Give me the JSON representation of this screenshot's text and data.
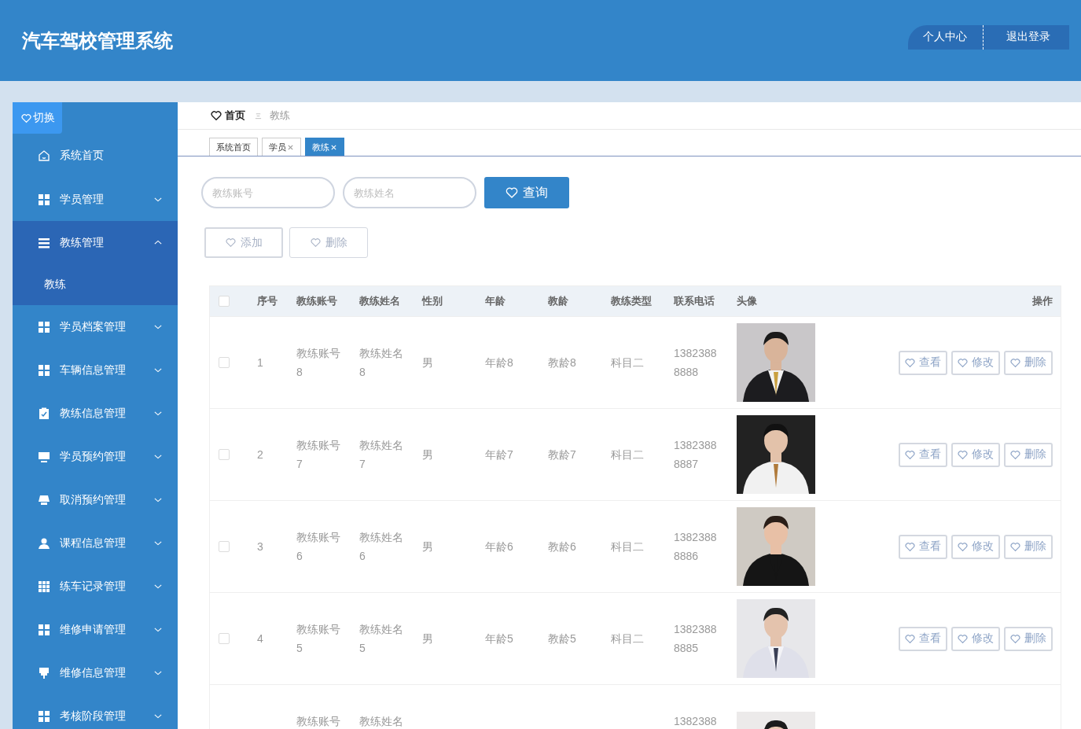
{
  "header": {
    "title": "汽车驾校管理系统",
    "user_menu": [
      "个人中心",
      "退出登录"
    ]
  },
  "sidebar": {
    "toggle": "切换",
    "items": [
      {
        "label": "系统首页",
        "kind": "link"
      },
      {
        "label": "学员管理",
        "kind": "group",
        "expanded": false
      },
      {
        "label": "教练管理",
        "kind": "group",
        "expanded": true,
        "children": [
          {
            "label": "教练",
            "selected": true
          }
        ]
      },
      {
        "label": "学员档案管理",
        "kind": "group",
        "expanded": false
      },
      {
        "label": "车辆信息管理",
        "kind": "group",
        "expanded": false
      },
      {
        "label": "教练信息管理",
        "kind": "group",
        "expanded": false
      },
      {
        "label": "学员预约管理",
        "kind": "group",
        "expanded": false
      },
      {
        "label": "取消预约管理",
        "kind": "group",
        "expanded": false
      },
      {
        "label": "课程信息管理",
        "kind": "group",
        "expanded": false
      },
      {
        "label": "练车记录管理",
        "kind": "group",
        "expanded": false
      },
      {
        "label": "维修申请管理",
        "kind": "group",
        "expanded": false
      },
      {
        "label": "维修信息管理",
        "kind": "group",
        "expanded": false
      },
      {
        "label": "考核阶段管理",
        "kind": "group",
        "expanded": false
      }
    ]
  },
  "breadcrumb": [
    "首页",
    "教练"
  ],
  "tabs": [
    {
      "label": "系统首页",
      "closable": false,
      "selected": false
    },
    {
      "label": "学员",
      "closable": true,
      "selected": false
    },
    {
      "label": "教练",
      "closable": true,
      "selected": true
    }
  ],
  "search": {
    "fields": [
      {
        "placeholder": "教练账号"
      },
      {
        "placeholder": "教练姓名"
      }
    ],
    "button": "查询"
  },
  "actions": [
    "添加",
    "删除"
  ],
  "table": {
    "select_all": {
      "checked": false
    },
    "columns": [
      "序号",
      "教练账号",
      "教练姓名",
      "性别",
      "年龄",
      "教龄",
      "教练类型",
      "联系电话",
      "头像",
      "操作"
    ],
    "rows": [
      {
        "checked": false,
        "cells": [
          "1",
          "教练账号8",
          "教练姓名8",
          "男",
          "年龄8",
          "教龄8",
          "科目二",
          "13823888888"
        ],
        "actions": [
          "查看",
          "修改",
          "删除"
        ]
      },
      {
        "checked": false,
        "cells": [
          "2",
          "教练账号7",
          "教练姓名7",
          "男",
          "年龄7",
          "教龄7",
          "科目二",
          "13823888887"
        ],
        "actions": [
          "查看",
          "修改",
          "删除"
        ]
      },
      {
        "checked": false,
        "cells": [
          "3",
          "教练账号6",
          "教练姓名6",
          "男",
          "年龄6",
          "教龄6",
          "科目二",
          "13823888886"
        ],
        "actions": [
          "查看",
          "修改",
          "删除"
        ]
      },
      {
        "checked": false,
        "cells": [
          "4",
          "教练账号5",
          "教练姓名5",
          "男",
          "年龄5",
          "教龄5",
          "科目二",
          "13823888885"
        ],
        "actions": [
          "查看",
          "修改",
          "删除"
        ]
      },
      {
        "cells": [
          "",
          "教练账号",
          "教练姓名",
          "",
          "",
          "",
          "",
          "1382388"
        ]
      }
    ]
  }
}
